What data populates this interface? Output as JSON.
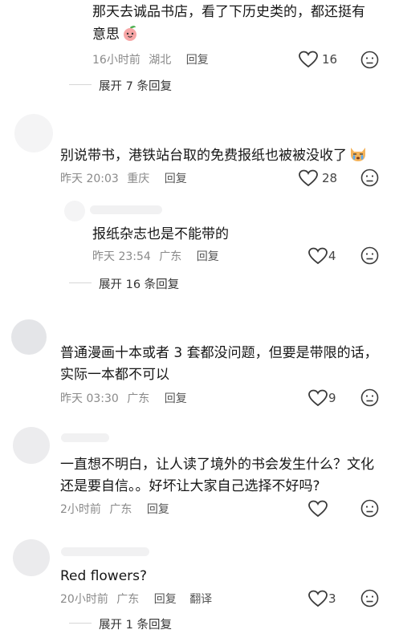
{
  "comments": [
    {
      "text_line1": "那天去诚品书店，看了下历史类的，都还挺有",
      "text_line2": "意思",
      "emoji_icon": "peach-face-emoji",
      "time": "16小时前",
      "location": "湖北",
      "reply_label": "回复",
      "likes": "16",
      "expand_label": "展开 7 条回复"
    },
    {
      "text_line1": "别说带书，港铁站台取的免费报纸也被被没收了",
      "emoji_icon": "crying-cat-emoji",
      "time": "昨天 20:03",
      "location": "重庆",
      "reply_label": "回复",
      "likes": "28",
      "sub_reply": {
        "text": "报纸杂志也是不能带的",
        "time": "昨天 23:54",
        "location": "广东",
        "reply_label": "回复",
        "likes": "4"
      },
      "expand_label": "展开 16 条回复"
    },
    {
      "text_line1": "普通漫画十本或者 3 套都没问题，但要是带限的话，",
      "text_line2": "实际一本都不可以",
      "time": "昨天 03:30",
      "location": "广东",
      "reply_label": "回复",
      "likes": "9"
    },
    {
      "text_line1": "一直想不明白，让人读了境外的书会发生什么？文化",
      "text_line2": "还是要自信。。好坏让大家自己选择不好吗?",
      "time": "2小时前",
      "location": "广东",
      "reply_label": "回复",
      "likes": ""
    },
    {
      "text_line1": "Red flowers?",
      "time": "20小时前",
      "location": "广东",
      "reply_label": "回复",
      "translate_label": "翻译",
      "likes": "3",
      "expand_label": "展开 1 条回复"
    }
  ],
  "colors": {
    "text": "#161616",
    "meta": "#8a8a8a",
    "icon": "#3a3a3a"
  }
}
